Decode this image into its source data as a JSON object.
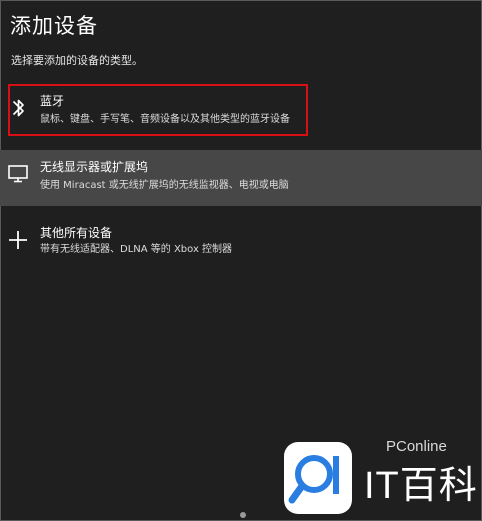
{
  "dialog": {
    "title": "添加设备",
    "subtitle": "选择要添加的设备的类型。"
  },
  "items": [
    {
      "icon": "bluetooth-icon",
      "name": "蓝牙",
      "desc": "鼠标、键盘、手写笔、音频设备以及其他类型的蓝牙设备",
      "highlighted_by_red_box": true
    },
    {
      "icon": "monitor-icon",
      "name": "无线显示器或扩展坞",
      "desc": "使用 Miracast 或无线扩展坞的无线监视器、电视或电脑",
      "hovered": true
    },
    {
      "icon": "plus-icon",
      "name": "其他所有设备",
      "desc": "带有无线适配器、DLNA 等的 Xbox 控制器"
    }
  ],
  "watermark": {
    "small": "PConline",
    "big": "IT百科"
  },
  "colors": {
    "background": "#1f1f1f",
    "hover_row": "#474747",
    "highlight_border": "#d80f14",
    "watermark_blue": "#2a7de1"
  }
}
